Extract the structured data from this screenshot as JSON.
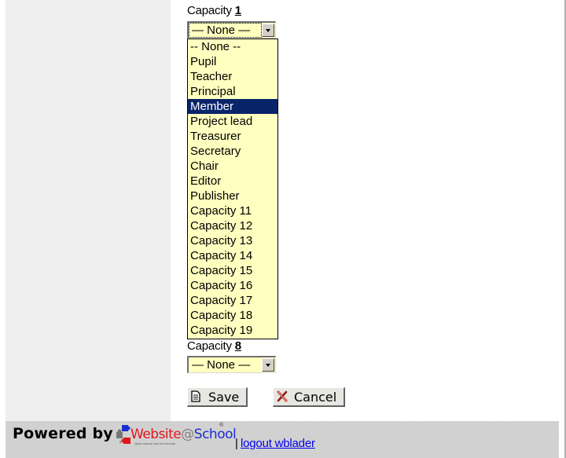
{
  "form": {
    "field1": {
      "label": "Capacity ",
      "accesskey": "1",
      "value": "— None —"
    },
    "dropdown": {
      "options": [
        "-- None --",
        "Pupil",
        "Teacher",
        "Principal",
        "Member",
        "Project lead",
        "Treasurer",
        "Secretary",
        "Chair",
        "Editor",
        "Publisher",
        "Capacity 11",
        "Capacity 12",
        "Capacity 13",
        "Capacity 14",
        "Capacity 15",
        "Capacity 16",
        "Capacity 17",
        "Capacity 18",
        "Capacity 19"
      ],
      "highlighted": "Member"
    },
    "field8": {
      "label": "Capacity ",
      "accesskey": "8",
      "value": "— None —"
    },
    "buttons": {
      "save": "Save",
      "cancel": "Cancel"
    }
  },
  "footer": {
    "powered_by": "Powered by",
    "logo": {
      "part1": "Website",
      "at": "@",
      "part2": "School",
      "tagline": "Open source cms for schools",
      "reg": "®"
    },
    "separator": "|",
    "logout": "logout wblader"
  },
  "colors": {
    "select_bg": "#ffffc0",
    "highlight_bg": "#0a246a",
    "footer_bg": "#cfcfcf",
    "sidebar_bg": "#eeeeee",
    "link": "#0000ee"
  }
}
